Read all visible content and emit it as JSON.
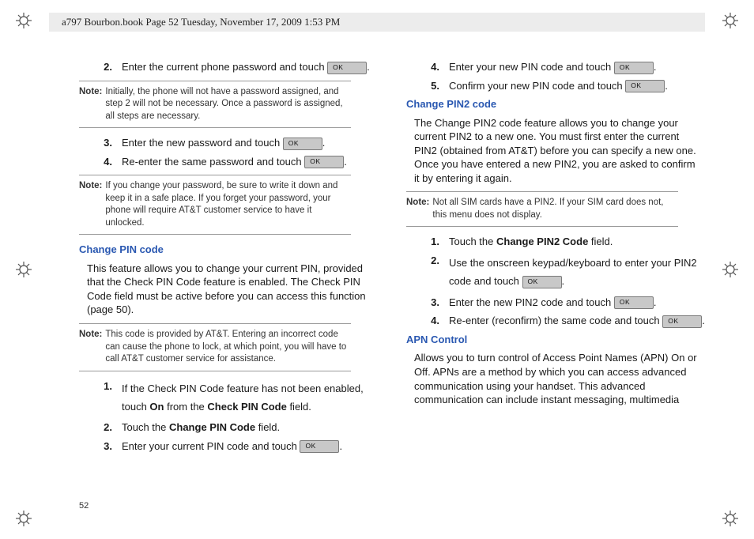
{
  "header": {
    "banner_text": "a797 Bourbon.book  Page 52  Tuesday, November 17, 2009  1:53 PM"
  },
  "ok_label": "OK",
  "page_number": "52",
  "left": {
    "items_a": [
      {
        "num": "2.",
        "pre": "Enter the current phone password and touch ",
        "post": "."
      }
    ],
    "note1": {
      "label": "Note:",
      "text": "Initially, the phone will not have a password assigned, and step 2 will not be necessary. Once a password is assigned, all steps are necessary."
    },
    "items_b": [
      {
        "num": "3.",
        "pre": "Enter the new password and touch ",
        "post": "."
      },
      {
        "num": "4.",
        "pre": "Re-enter the same password and touch ",
        "post": "."
      }
    ],
    "note2": {
      "label": "Note:",
      "text": "If you change your password, be sure to write it down and keep it in a safe place. If you forget your password, your phone will require AT&T customer service to have it unlocked."
    },
    "heading1": "Change PIN code",
    "para1": "This feature allows you to change your current PIN, provided that the Check PIN Code feature is enabled. The Check PIN Code field must be active before you can access this function (page 50).",
    "note3": {
      "label": "Note:",
      "text": "This code is provided by AT&T. Entering an incorrect code can cause the phone to lock, at which point, you will have to call AT&T customer service for assistance."
    },
    "items_c": {
      "i1": {
        "num": "1.",
        "pre": "If the Check PIN Code feature has not been enabled, touch ",
        "bold1": "On",
        "mid": " from the ",
        "bold2": "Check PIN Code",
        "post": " field."
      },
      "i2": {
        "num": "2.",
        "pre": "Touch the ",
        "bold1": "Change PIN Code",
        "post": " field."
      },
      "i3": {
        "num": "3.",
        "pre": "Enter your current PIN code and touch ",
        "post": "."
      }
    }
  },
  "right": {
    "items_d": [
      {
        "num": "4.",
        "pre": "Enter your new PIN code and touch ",
        "post": "."
      },
      {
        "num": "5.",
        "pre": "Confirm your new PIN code and touch ",
        "post": "."
      }
    ],
    "heading2": "Change PIN2 code",
    "para2": "The Change PIN2 code feature allows you to change your current PIN2 to a new one. You must first enter the current PIN2 (obtained from AT&T) before you can specify a new one. Once you have entered a new PIN2, you are asked to confirm it by entering it again.",
    "note4": {
      "label": "Note:",
      "text": "Not all SIM cards have a PIN2. If your SIM card does not, this menu does not display."
    },
    "items_e": {
      "i1": {
        "num": "1.",
        "pre": "Touch the ",
        "bold1": "Change PIN2 Code",
        "post": " field."
      },
      "i2": {
        "num": "2.",
        "pre": "Use the onscreen keypad/keyboard to enter your PIN2 code and touch ",
        "post": "."
      },
      "i3": {
        "num": "3.",
        "pre": "Enter the new PIN2 code and touch ",
        "post": "."
      },
      "i4": {
        "num": "4.",
        "pre": "Re-enter (reconfirm) the same code and touch ",
        "post": "."
      }
    },
    "heading3": "APN Control",
    "para3": "Allows you to turn control of Access Point Names (APN) On or Off. APNs are a method by which you can access advanced communication using your handset. This advanced communication can include instant messaging, multimedia"
  }
}
